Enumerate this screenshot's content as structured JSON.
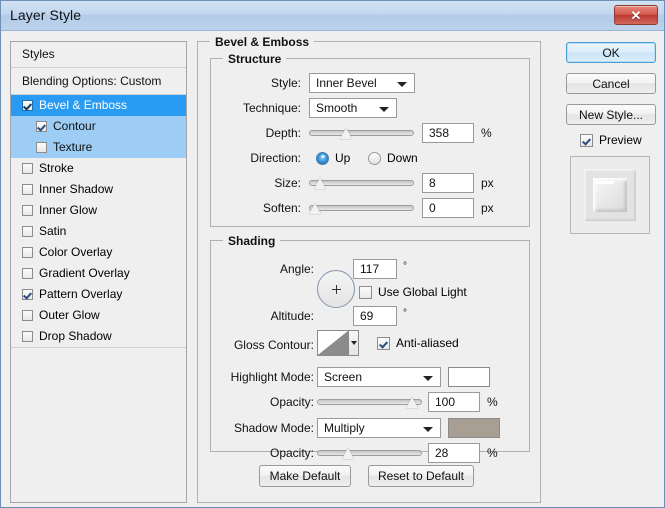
{
  "window": {
    "title": "Layer Style",
    "close_label": "✕",
    "accent_title_color": "#c2d7ef",
    "close_color": "#c9483c"
  },
  "styles_panel": {
    "header": "Styles",
    "blending_options": "Blending Options: Custom",
    "effects": [
      {
        "label": "Bevel & Emboss",
        "checked": true,
        "selected": true,
        "sub": false
      },
      {
        "label": "Contour",
        "checked": true,
        "selected": false,
        "sub": true
      },
      {
        "label": "Texture",
        "checked": false,
        "selected": false,
        "sub": true
      },
      {
        "label": "Stroke",
        "checked": false,
        "selected": false,
        "sub": false
      },
      {
        "label": "Inner Shadow",
        "checked": false,
        "selected": false,
        "sub": false
      },
      {
        "label": "Inner Glow",
        "checked": false,
        "selected": false,
        "sub": false
      },
      {
        "label": "Satin",
        "checked": false,
        "selected": false,
        "sub": false
      },
      {
        "label": "Color Overlay",
        "checked": false,
        "selected": false,
        "sub": false
      },
      {
        "label": "Gradient Overlay",
        "checked": false,
        "selected": false,
        "sub": false
      },
      {
        "label": "Pattern Overlay",
        "checked": true,
        "selected": false,
        "sub": false
      },
      {
        "label": "Outer Glow",
        "checked": false,
        "selected": false,
        "sub": false
      },
      {
        "label": "Drop Shadow",
        "checked": false,
        "selected": false,
        "sub": false
      }
    ]
  },
  "bevel": {
    "group_title": "Bevel & Emboss",
    "structure": {
      "group_title": "Structure",
      "style_label": "Style:",
      "style_value": "Inner Bevel",
      "technique_label": "Technique:",
      "technique_value": "Smooth",
      "depth_label": "Depth:",
      "depth_value": "358",
      "depth_unit": "%",
      "depth_slider_pct": 34,
      "direction_label": "Direction:",
      "direction_up": "Up",
      "direction_down": "Down",
      "direction_selected": "Up",
      "size_label": "Size:",
      "size_value": "8",
      "size_unit": "px",
      "size_slider_pct": 5,
      "soften_label": "Soften:",
      "soften_value": "0",
      "soften_unit": "px",
      "soften_slider_pct": 0
    },
    "shading": {
      "group_title": "Shading",
      "angle_label": "Angle:",
      "angle_value": "117",
      "angle_unit": "°",
      "use_global_light": "Use Global Light",
      "use_global_light_checked": false,
      "altitude_label": "Altitude:",
      "altitude_value": "69",
      "altitude_unit": "°",
      "gloss_contour_label": "Gloss Contour:",
      "anti_aliased": "Anti-aliased",
      "anti_aliased_checked": true,
      "highlight_mode_label": "Highlight Mode:",
      "highlight_mode_value": "Screen",
      "highlight_color": "#ffffff",
      "highlight_opacity_label": "Opacity:",
      "highlight_opacity_value": "100",
      "highlight_opacity_unit": "%",
      "highlight_opacity_pct": 97,
      "shadow_mode_label": "Shadow Mode:",
      "shadow_mode_value": "Multiply",
      "shadow_color": "#a89e93",
      "shadow_opacity_label": "Opacity:",
      "shadow_opacity_value": "28",
      "shadow_opacity_unit": "%",
      "shadow_opacity_pct": 27
    },
    "make_default": "Make Default",
    "reset_to_default": "Reset to Default"
  },
  "side": {
    "ok": "OK",
    "cancel": "Cancel",
    "new_style": "New Style...",
    "preview_label": "Preview",
    "preview_checked": true
  }
}
